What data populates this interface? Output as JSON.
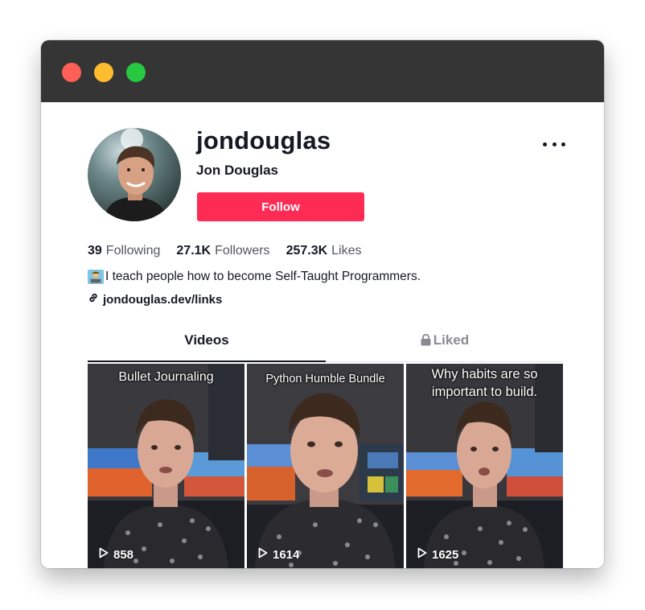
{
  "window": {
    "controls": [
      "close",
      "minimize",
      "maximize"
    ],
    "colors": {
      "close": "#ff5f57",
      "minimize": "#febc2e",
      "maximize": "#28c840"
    }
  },
  "profile": {
    "username": "jondouglas",
    "display_name": "Jon Douglas",
    "follow_label": "Follow",
    "follow_color": "#fe2c55",
    "stats": [
      {
        "value": "39",
        "label": "Following"
      },
      {
        "value": "27.1K",
        "label": "Followers"
      },
      {
        "value": "257.3K",
        "label": "Likes"
      }
    ],
    "bio": "I teach people how to become Self-Taught Programmers.",
    "bio_icon": "technologist-emoji",
    "link": "jondouglas.dev/links",
    "link_icon": "link-icon",
    "more_icon": "more-horizontal-icon"
  },
  "tabs": [
    {
      "label": "Videos",
      "active": true
    },
    {
      "label": "Liked",
      "active": false,
      "icon": "lock-icon"
    }
  ],
  "videos": [
    {
      "caption": "Bullet Journaling",
      "views": "858"
    },
    {
      "caption": "Python Humble Bundle",
      "views": "1614"
    },
    {
      "caption": "Why habits are so important to build.",
      "views": "1625"
    }
  ]
}
